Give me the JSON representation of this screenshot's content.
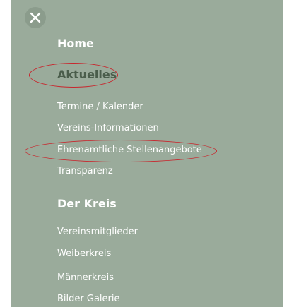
{
  "menu": {
    "close_icon": "close-icon",
    "items": [
      {
        "label": "Home"
      },
      {
        "label": "Aktuelles"
      },
      {
        "label": "Termine / Kalender"
      },
      {
        "label": "Vereins-Informationen"
      },
      {
        "label": "Ehrenamtliche Stellenangebote"
      },
      {
        "label": "Transparenz"
      },
      {
        "label": "Der Kreis"
      },
      {
        "label": "Vereinsmitglieder"
      },
      {
        "label": "Weiberkreis"
      },
      {
        "label": "Männerkreis"
      },
      {
        "label": "Bilder Galerie"
      }
    ]
  },
  "colors": {
    "panel_background": "#9aab9b",
    "active_text": "#4a5d4b",
    "annotation_ring": "#c8262d"
  }
}
